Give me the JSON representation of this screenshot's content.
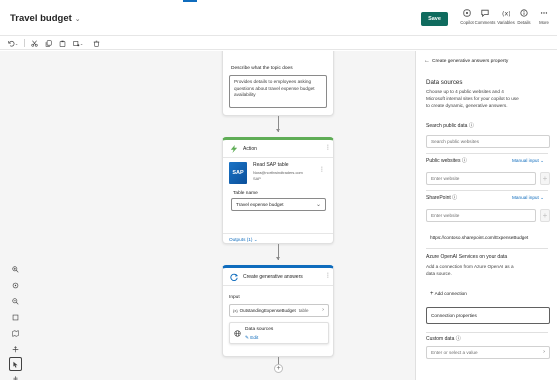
{
  "header": {
    "title": "Travel budget",
    "save_label": "Save",
    "buttons": [
      {
        "label": "Copilot",
        "icon": "copilot-icon"
      },
      {
        "label": "Comments",
        "icon": "comment-icon"
      },
      {
        "label": "Variables",
        "icon": "variables-icon"
      },
      {
        "label": "Details",
        "icon": "info-icon"
      },
      {
        "label": "More",
        "icon": "more-icon"
      }
    ]
  },
  "toolbar": {
    "icons": [
      "undo-icon",
      "cut-icon",
      "copy-icon",
      "paste-icon",
      "format-icon",
      "delete-icon"
    ]
  },
  "canvas": {
    "topic_node": {
      "label": "Describe what the topic does",
      "description": "Provides details to employees asking questions about travel expense budget availability"
    },
    "action_node": {
      "title": "Action",
      "connector_name": "Read SAP table",
      "connector_account": "Nora@northwindtraders.com",
      "connector_type": "SAP",
      "logo_text": "SAP",
      "table_label": "Table name",
      "table_value": "Travel expense budget",
      "outputs_label": "Outputs (1)"
    },
    "gen_node": {
      "title": "Create generative answers",
      "input_label": "Input",
      "input_variable": "OutstandingExpenseBudget",
      "input_type": "table",
      "datasources_label": "Data sources",
      "edit_label": "Edit"
    }
  },
  "panel": {
    "back_title": "Create generative answers property",
    "heading": "Data sources",
    "intro": [
      "Choose up to 4 public websites and 4",
      "Microsoft internal sites for your copilot to use",
      "to create dynamic, generative answers."
    ],
    "search_label": "Search public data",
    "search_placeholder": "Search public websites",
    "public_websites_label": "Public websites",
    "public_mode": "Manual input",
    "public_placeholder": "Enter website",
    "sharepoint_label": "SharePoint",
    "sharepoint_mode": "Manual input",
    "sharepoint_placeholder": "Enter website",
    "sharepoint_url": "https://contoso.sharepoint.com/ExpenseBudget",
    "azure_heading": "Azure OpenAI Services on your data",
    "azure_desc": [
      "Add a connection from Azure OpenAI as a",
      "data source."
    ],
    "add_connection": "Add connection",
    "connection_properties": "Connection properties",
    "custom_label": "Custom data",
    "custom_placeholder": "Enter or select a value"
  }
}
